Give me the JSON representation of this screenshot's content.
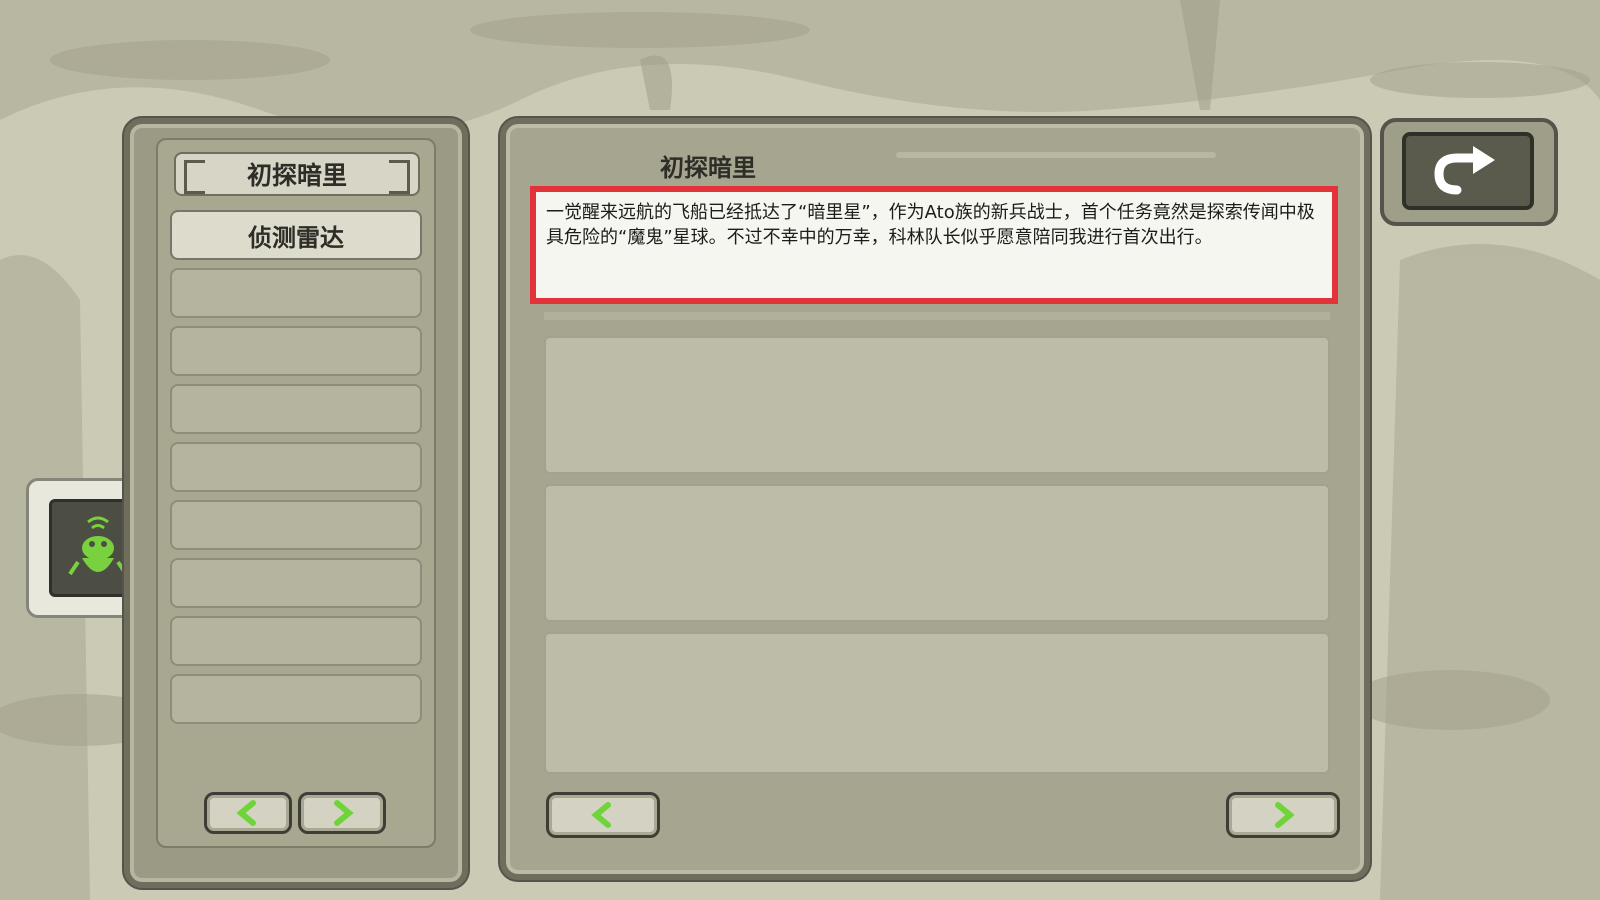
{
  "left_panel": {
    "header_title": "初探暗里",
    "quests": [
      "侦测雷达"
    ],
    "empty_slot_count": 8
  },
  "main_panel": {
    "title": "初探暗里",
    "description": "一觉醒来远航的飞船已经抵达了“暗里星”，作为Ato族的新兵战士，首个任务竟然是探索传闻中极具危险的“魔鬼”星球。不过不幸中的万幸，科林队长似乎愿意陪同我进行首次出行。"
  },
  "colors": {
    "highlight_border": "#e2323a",
    "arrow_green": "#6fd43a",
    "radar_green": "#7ad13f"
  },
  "icons": {
    "back": "return-arrow-icon",
    "prev": "chevron-left-icon",
    "next": "chevron-right-icon",
    "radar": "radar-creature-icon"
  }
}
